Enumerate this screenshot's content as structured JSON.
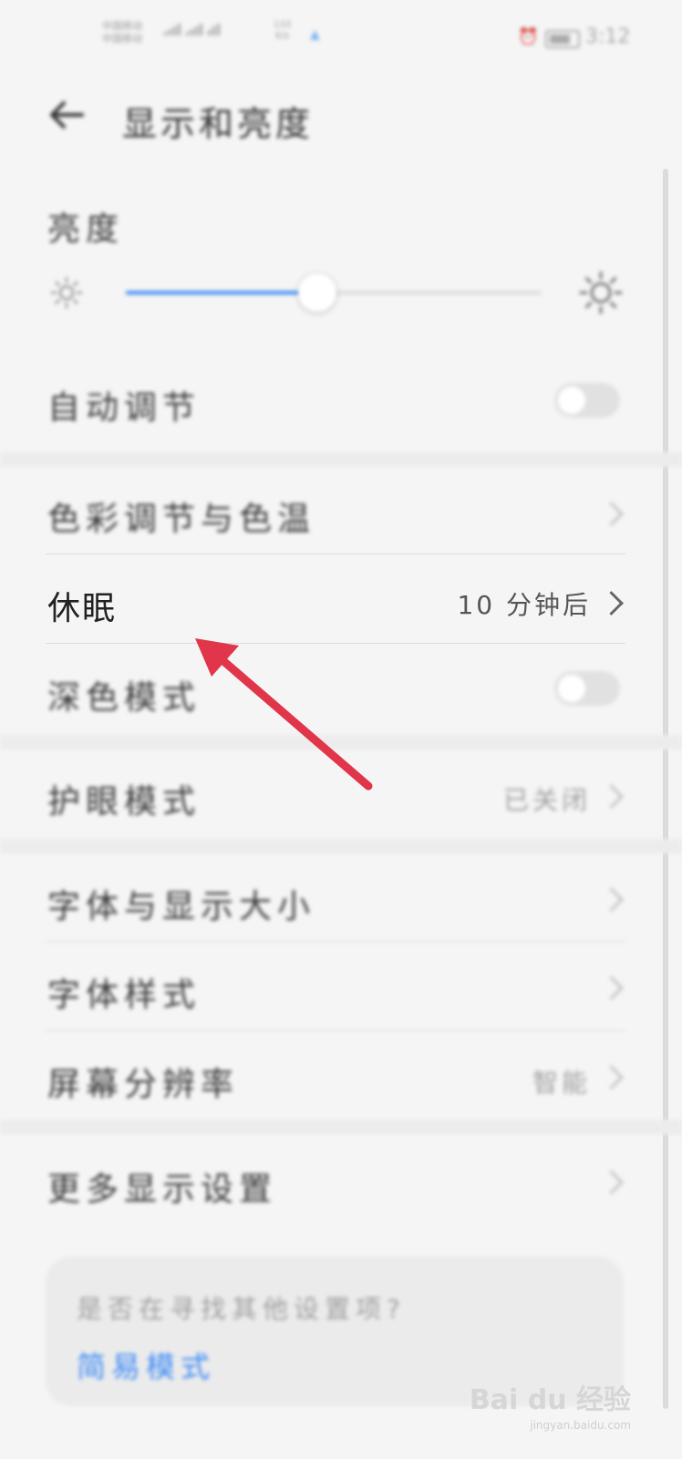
{
  "status_bar": {
    "carrier_1": "中国移动",
    "carrier_2": "中国移动",
    "net_speed": "133",
    "net_unit": "K/s",
    "time": "3:12",
    "battery_level": 0.85
  },
  "header": {
    "title": "显示和亮度"
  },
  "brightness": {
    "section_label": "亮度",
    "slider_level": 0.46
  },
  "settings": {
    "auto_adjust": {
      "label": "自动调节",
      "on": false
    },
    "color_temp": {
      "label": "色彩调节与色温"
    },
    "sleep": {
      "label": "休眠",
      "value": "10 分钟后"
    },
    "dark_mode": {
      "label": "深色模式",
      "on": false
    },
    "eye_comfort": {
      "label": "护眼模式",
      "value": "已关闭"
    },
    "font_size": {
      "label": "字体与显示大小"
    },
    "font_style": {
      "label": "字体样式"
    },
    "resolution": {
      "label": "屏幕分辨率",
      "value": "智能"
    },
    "more_display": {
      "label": "更多显示设置"
    }
  },
  "hint_card": {
    "question": "是否在寻找其他设置项?",
    "link": "简易模式"
  },
  "watermark": {
    "brand": "Bai du 经验",
    "url": "jingyan.baidu.com"
  },
  "colors": {
    "accent": "#3d8af7",
    "arrow": "#e0354a",
    "background": "#f5f5f5"
  },
  "icons": {
    "back": "back-arrow-icon",
    "sun_small": "sun-small-icon",
    "sun_large": "sun-large-icon",
    "chevron": "chevron-right-icon"
  }
}
